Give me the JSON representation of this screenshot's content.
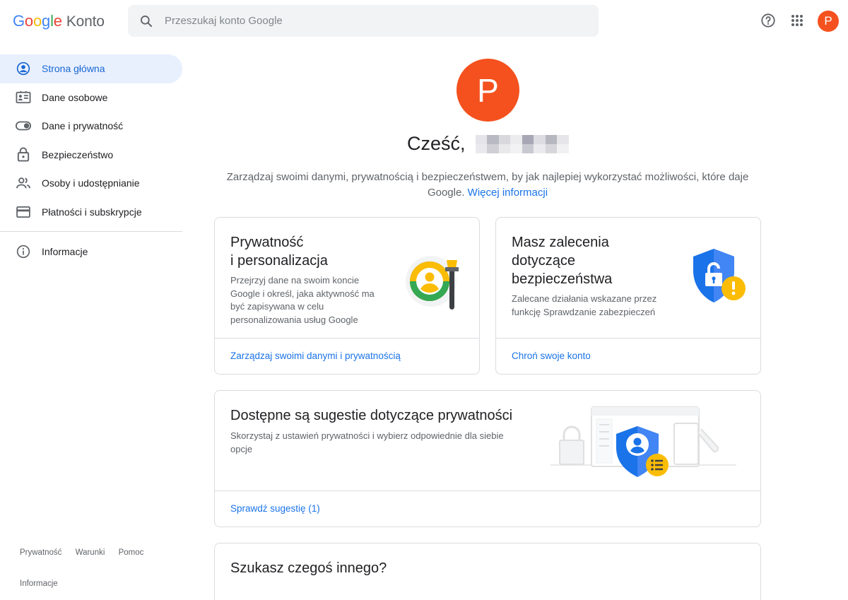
{
  "header": {
    "logo_letters": [
      "G",
      "o",
      "o",
      "g",
      "l",
      "e"
    ],
    "product": "Konto",
    "search_placeholder": "Przeszukaj konto Google",
    "avatar_letter": "P"
  },
  "sidebar": {
    "items": [
      {
        "label": "Strona główna",
        "icon": "person-circle-icon",
        "active": true
      },
      {
        "label": "Dane osobowe",
        "icon": "id-card-icon"
      },
      {
        "label": "Dane i prywatność",
        "icon": "toggle-icon"
      },
      {
        "label": "Bezpieczeństwo",
        "icon": "lock-icon"
      },
      {
        "label": "Osoby i udostępnianie",
        "icon": "people-icon"
      },
      {
        "label": "Płatności i subskrypcje",
        "icon": "credit-card-icon"
      }
    ],
    "info_item": {
      "label": "Informacje",
      "icon": "info-icon"
    },
    "footer": {
      "privacy": "Prywatność",
      "terms": "Warunki",
      "help": "Pomoc",
      "info": "Informacje"
    }
  },
  "main": {
    "avatar_letter": "P",
    "greeting": "Cześć,",
    "intro_text": "Zarządzaj swoimi danymi, prywatnością i bezpieczeństwem, by jak najlepiej wykorzystać możliwości, które daje Google.",
    "intro_link": "Więcej informacji",
    "cards": {
      "privacy": {
        "title_line1": "Prywatność",
        "title_line2": "i personalizacja",
        "desc": "Przejrzyj dane na swoim koncie Google i określ, jaka aktywność ma być zapisywana w celu personalizowania usług Google",
        "link": "Zarządzaj swoimi danymi i prywatnością"
      },
      "security": {
        "title": "Masz zalecenia dotyczące bezpieczeństwa",
        "desc": "Zalecane działania wskazane przez funkcję Sprawdzanie zabezpieczeń",
        "link": "Chroń swoje konto"
      },
      "suggestions": {
        "title": "Dostępne są sugestie dotyczące prywatności",
        "desc": "Skorzystaj z ustawień prywatności i wybierz odpowiednie dla siebie opcje",
        "link": "Sprawdź sugestię (1)"
      },
      "search_more": {
        "title": "Szukasz czegoś innego?"
      }
    }
  },
  "colors": {
    "accent": "#1a73e8",
    "avatar": "#f4511e",
    "active_nav_bg": "#e8f0fe"
  }
}
